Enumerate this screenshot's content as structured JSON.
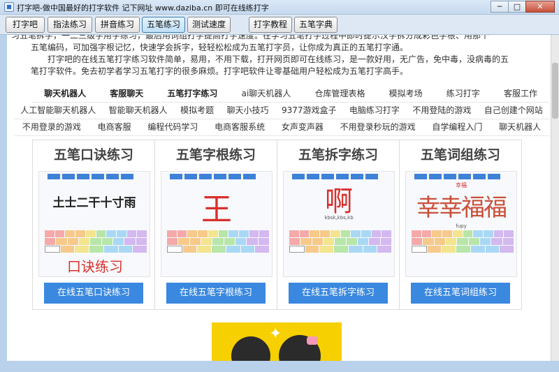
{
  "window": {
    "title": "打字吧-做中国最好的打字软件 记下网址 www.daziba.cn 即可在线练打字",
    "minimize": "─",
    "maximize": "□",
    "close": "✕"
  },
  "toolbar": {
    "buttons": [
      "打字吧",
      "指法练习",
      "拼音练习",
      "五笔练习",
      "测试速度",
      "打字教程",
      "五笔字典"
    ],
    "active": "五笔练习"
  },
  "intro": {
    "line1": "习五笔拆字，一二三级字用字练习，最后用词组打字提高打字速度。在学习五笔打字过程中即时提示汉字拆分成彩色字根、用那个",
    "line2": "五笔编码，可加强字根记忆，快速学会拆字，轻轻松松成为五笔打字员，让你成为真正的五笔打字通。",
    "line3": "打字吧的在线五笔打字练习软件简单，易用，不用下载，打开网页即可在线练习，是一款好用，无广告，免中毒，没病毒的五",
    "line4": "笔打字软件。免去初学者学习五笔打字的很多麻烦。打字吧软件让零基础用户轻松成为五笔打字高手。"
  },
  "tags": {
    "row1": [
      "聊天机器人",
      "客服聊天",
      "五笔打字练习",
      "ai聊天机器人",
      "仓库管理表格",
      "模拟考场",
      "练习打字",
      "客服工作"
    ],
    "row2": [
      "人工智能聊天机器人",
      "智能聊天机器人",
      "模拟考题",
      "聊天小技巧",
      "9377游戏盒子",
      "电脑练习打字",
      "不用登陆的游戏",
      "自己创建个网站"
    ],
    "row3": [
      "不用登录的游戏",
      "电商客服",
      "编程代码学习",
      "电商客服系统",
      "女声变声器",
      "不用登录秒玩的游戏",
      "自学编程入门",
      "聊天机器人"
    ]
  },
  "cards": [
    {
      "title": "五笔口诀练习",
      "preview_text": "土士二干十寸雨",
      "overlay_text": "口诀练习",
      "button": "在线五笔口诀练习"
    },
    {
      "title": "五笔字根练习",
      "preview_text": "王",
      "button": "在线五笔字根练习"
    },
    {
      "title": "五笔拆字练习",
      "preview_text": "啊",
      "code_text": "kbsk,kbs,kb",
      "button": "在线五笔拆字练习"
    },
    {
      "title": "五笔词组练习",
      "preview_text": "幸幸福福",
      "small_label": "幸福",
      "code_text": "fupy",
      "button": "在线五笔词组练习"
    }
  ],
  "colors": {
    "button_blue": "#3a88e0",
    "title_gray": "#444444",
    "glyph_red": "#d9302c"
  },
  "icons": {
    "banner_star": "✦"
  }
}
